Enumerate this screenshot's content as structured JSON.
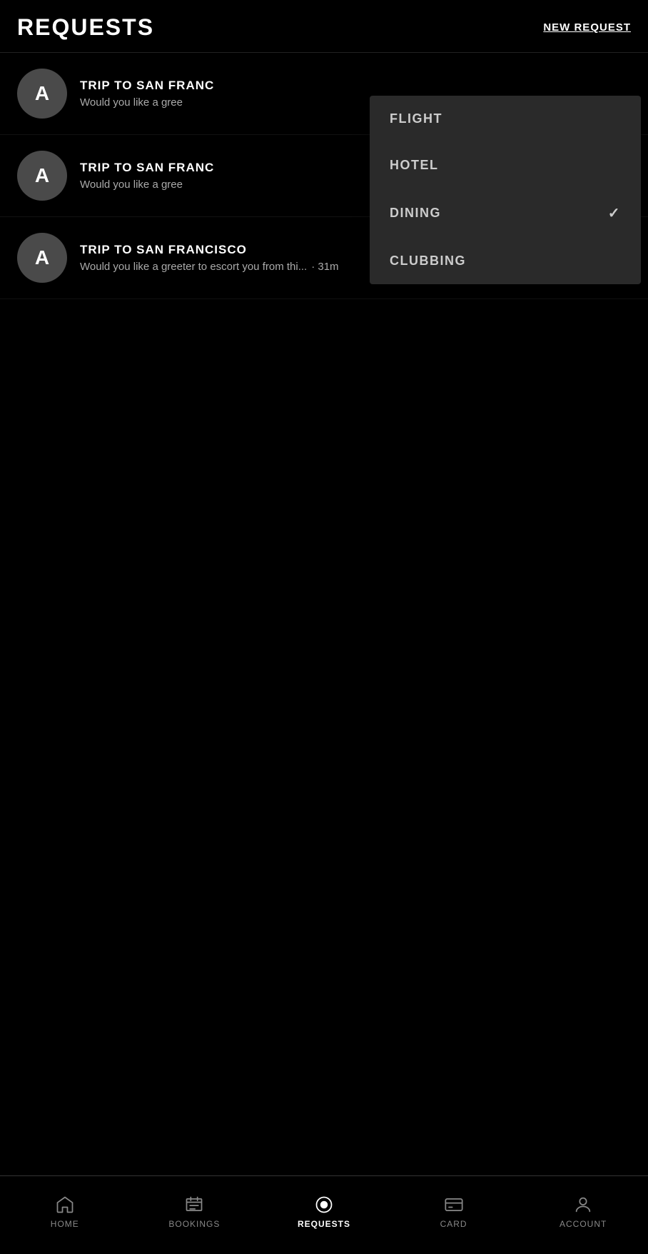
{
  "header": {
    "title": "REQUESTS",
    "new_request_label": "NEW REQUEST"
  },
  "requests": [
    {
      "id": 1,
      "avatar_letter": "A",
      "title": "TRIP TO SAN FRANC",
      "preview": "Would you like a gree",
      "time": null,
      "truncated": true
    },
    {
      "id": 2,
      "avatar_letter": "A",
      "title": "TRIP TO SAN FRANC",
      "preview": "Would you like a gree",
      "time": null,
      "truncated": true
    },
    {
      "id": 3,
      "avatar_letter": "A",
      "title": "TRIP TO SAN FRANCISCO",
      "preview": "Would you like a greeter to escort you from thi...",
      "time": "31m",
      "truncated": false
    }
  ],
  "dropdown": {
    "items": [
      {
        "label": "FLIGHT",
        "selected": false
      },
      {
        "label": "HOTEL",
        "selected": false
      },
      {
        "label": "DINING",
        "selected": true
      },
      {
        "label": "CLUBBING",
        "selected": false
      }
    ]
  },
  "bottom_nav": {
    "items": [
      {
        "id": "home",
        "label": "HOME",
        "active": false,
        "icon": "home"
      },
      {
        "id": "bookings",
        "label": "BOOKINGS",
        "active": false,
        "icon": "bookings"
      },
      {
        "id": "requests",
        "label": "REQUESTS",
        "active": true,
        "icon": "requests"
      },
      {
        "id": "card",
        "label": "CARD",
        "active": false,
        "icon": "card"
      },
      {
        "id": "account",
        "label": "ACCOUNT",
        "active": false,
        "icon": "account"
      }
    ]
  }
}
